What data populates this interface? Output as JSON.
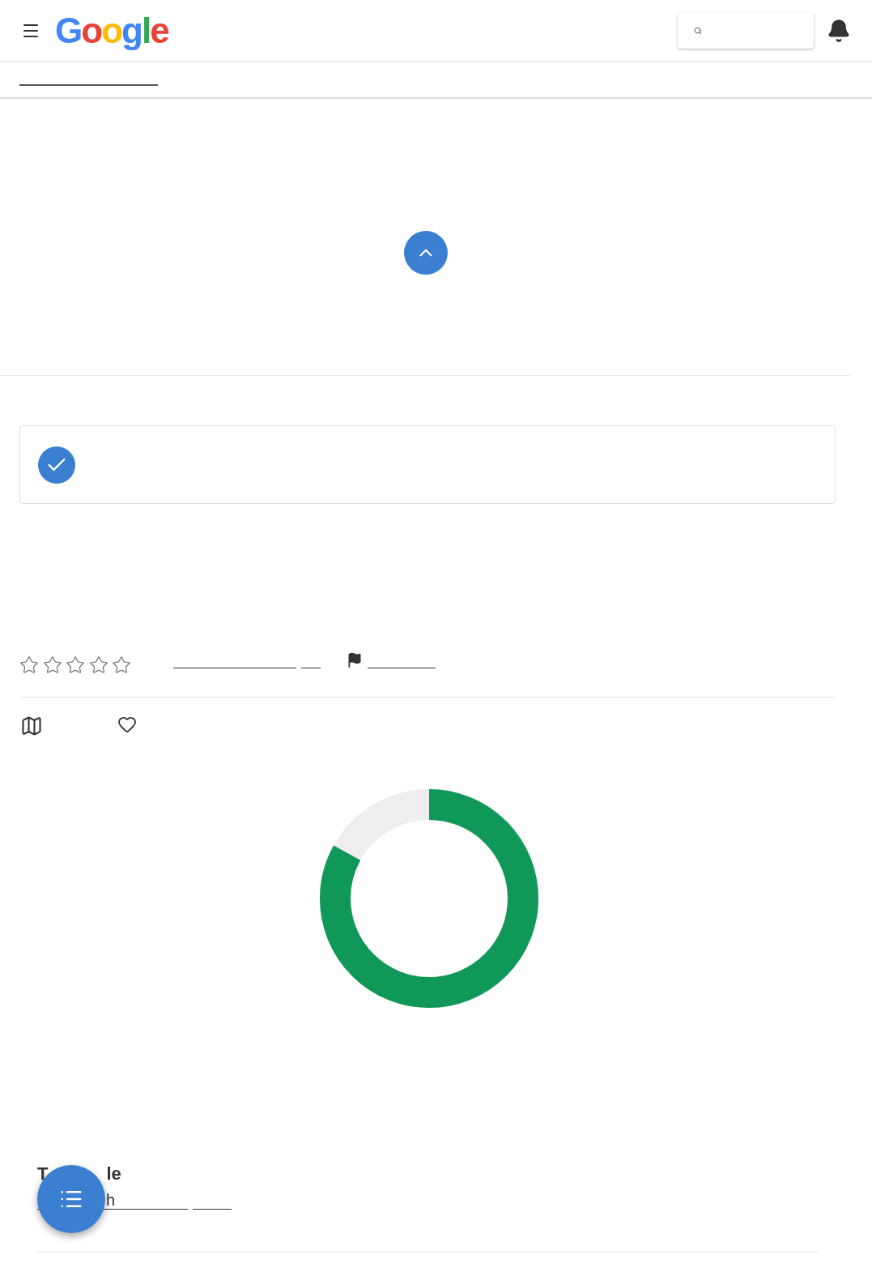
{
  "header": {
    "logo": "Google"
  },
  "tabs": [
    {
      "selected": true
    }
  ],
  "rating": {
    "stars": 0
  },
  "status_card": {
    "checked": true
  },
  "section": {
    "heading_start": "T",
    "heading_end": "le",
    "subline_start": "h"
  }
}
